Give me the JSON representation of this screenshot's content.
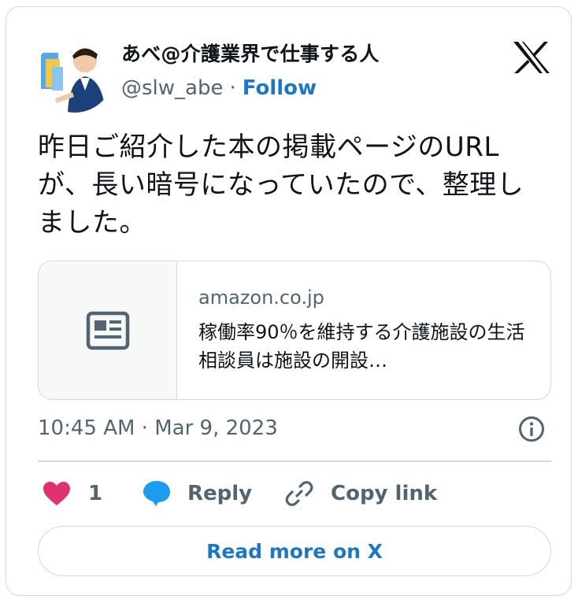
{
  "author": {
    "name": "あべ@介護業界で仕事する人",
    "handle": "@slw_abe",
    "separator": "·",
    "follow_label": "Follow",
    "avatar_icon": "profile-photo"
  },
  "tweet": {
    "text": "昨日ご紹介した本の掲載ページのURLが、長い暗号になっていたので、整理しました。",
    "timestamp": "10:45 AM · Mar 9, 2023"
  },
  "link_preview": {
    "domain": "amazon.co.jp",
    "title": "稼働率90％を維持する介護施設の生活相談員は施設の開設…",
    "thumb_icon": "article-icon"
  },
  "actions": {
    "like_count": "1",
    "reply_label": "Reply",
    "copy_label": "Copy link"
  },
  "read_more_label": "Read more on X",
  "colors": {
    "accent": "#1d77c2",
    "like": "#e0316e",
    "muted": "#536471",
    "border": "#cfd9de"
  }
}
